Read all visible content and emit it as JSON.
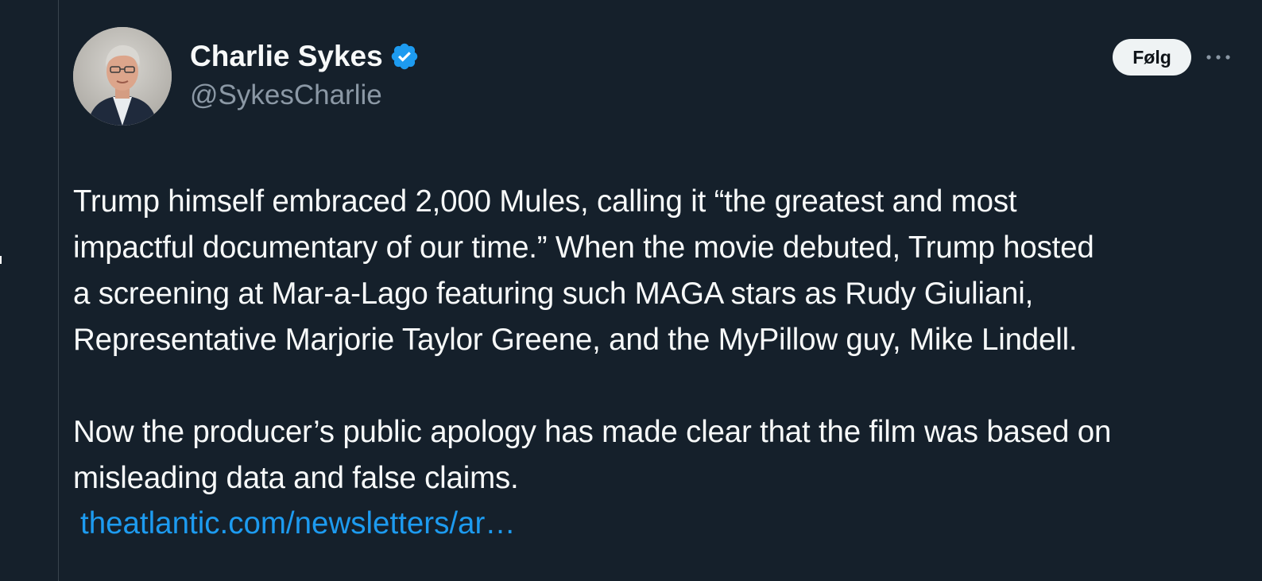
{
  "author": {
    "display_name": "Charlie Sykes",
    "handle": "@SykesCharlie",
    "verified": true,
    "verified_color": "#1d9bf0"
  },
  "actions": {
    "follow_label": "Følg",
    "more_icon": "more-horizontal-icon"
  },
  "tweet": {
    "paragraph_1": "Trump himself embraced 2,000 Mules, calling it “the greatest and most\nimpactful documentary of our time.” When the movie debuted, Trump hosted\na screening at Mar-a-Lago featuring such MAGA stars as Rudy Giuliani,\nRepresentative Marjorie Taylor Greene, and the MyPillow guy, Mike Lindell.",
    "paragraph_2": "Now the producer’s public apology has made clear that the film was based on\nmisleading data and false claims.",
    "link_text": "theatlantic.com/newsletters/ar…"
  },
  "colors": {
    "background": "#15202b",
    "text": "#f7f9f9",
    "secondary_text": "#8b98a5",
    "link": "#1d9bf0"
  }
}
